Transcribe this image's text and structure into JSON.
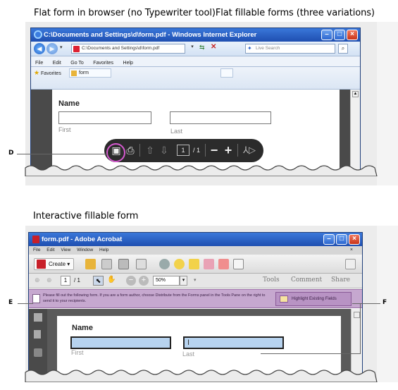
{
  "top": {
    "heading": "Flat form in browser (no Typewriter tool)Flat fillable forms (three variations)",
    "ie": {
      "title": "C:\\Documents and Settings\\d\\form.pdf - Windows Internet Explorer",
      "address": "C:\\Documents and Settings\\d\\form.pdf",
      "search_placeholder": "Live Search",
      "menu": [
        "File",
        "Edit",
        "Go To",
        "Favorites",
        "Help"
      ],
      "favorites_label": "Favorites",
      "tab_label": "form",
      "form": {
        "name_label": "Name",
        "first_label": "First",
        "last_label": "Last"
      },
      "hud": {
        "page_number": "1",
        "page_total": "/ 1"
      }
    },
    "callout_d": "D"
  },
  "bottom": {
    "heading": "Interactive fillable form",
    "acrobat": {
      "title": "form.pdf - Adobe Acrobat",
      "menu": [
        "File",
        "Edit",
        "View",
        "Window",
        "Help"
      ],
      "create_label": "Create",
      "page_number": "1",
      "page_total": "/ 1",
      "zoom": "50%",
      "tabs": [
        "Tools",
        "Comment",
        "Share"
      ],
      "notice": "Please fill out the following form. If you are a form author, choose Distribute from the Forms panel in the Tools Pane on the right to send it to your recipients.",
      "highlight_button": "Highlight Existing Fields",
      "form": {
        "name_label": "Name",
        "first_label": "First",
        "last_label": "Last"
      }
    },
    "callout_e": "E",
    "callout_f": "F"
  },
  "colors": {
    "ie_title": "#2a62c9",
    "notice_bg": "#c6a8cf",
    "field_highlight": "#b7d3ef",
    "save_circle": "#d65ad0"
  }
}
